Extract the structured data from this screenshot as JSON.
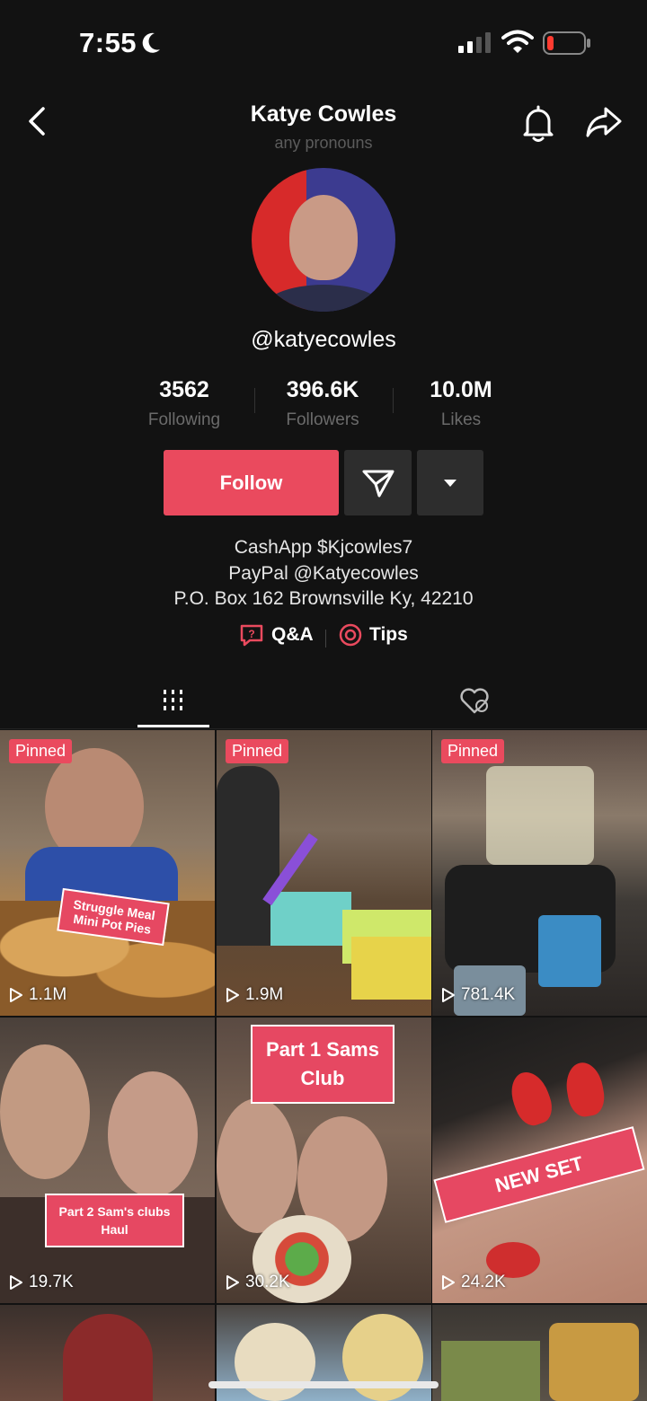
{
  "status_bar": {
    "time": "7:55"
  },
  "header": {
    "display_name": "Katye Cowles",
    "pronouns": "any pronouns"
  },
  "profile": {
    "username": "@katyecowles",
    "stats": [
      {
        "value": "3562",
        "label": "Following"
      },
      {
        "value": "396.6K",
        "label": "Followers"
      },
      {
        "value": "10.0M",
        "label": "Likes"
      }
    ],
    "follow_label": "Follow",
    "bio_lines": [
      "CashApp $Kjcowles7",
      "PayPal @Katyecowles",
      "P.O. Box 162 Brownsville Ky, 42210"
    ],
    "links": [
      {
        "label": "Q&A"
      },
      {
        "label": "Tips"
      }
    ]
  },
  "videos": [
    {
      "pinned_label": "Pinned",
      "views": "1.1M",
      "caption": "Struggle Meal Mini Pot Pies"
    },
    {
      "pinned_label": "Pinned",
      "views": "1.9M",
      "caption": ""
    },
    {
      "pinned_label": "Pinned",
      "views": "781.4K",
      "caption": ""
    },
    {
      "pinned_label": "",
      "views": "19.7K",
      "caption": "Part 2 Sam's clubs Haul"
    },
    {
      "pinned_label": "",
      "views": "30.2K",
      "caption": "Part 1 Sams Club"
    },
    {
      "pinned_label": "",
      "views": "24.2K",
      "caption": "NEW SET"
    }
  ],
  "colors": {
    "accent": "#ea4a5e",
    "background": "#121212",
    "button_dark": "#2d2d2d",
    "muted_text": "#6b6b6b"
  }
}
